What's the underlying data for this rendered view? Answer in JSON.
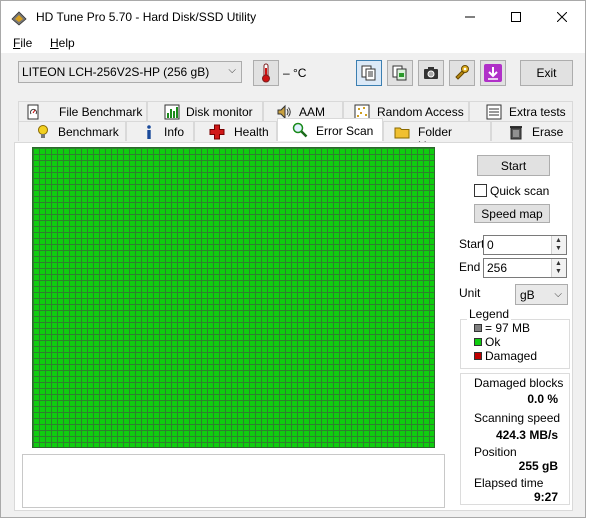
{
  "window": {
    "title": "HD Tune Pro 5.70 - Hard Disk/SSD Utility",
    "minimize": "—",
    "maximize": "☐",
    "close": "✕"
  },
  "menu": {
    "file_u": "F",
    "file_rest": "ile",
    "help_u": "H",
    "help_rest": "elp"
  },
  "toolbar": {
    "drive": "LITEON LCH-256V2S-HP (256 gB)",
    "temperature": "– °C",
    "exit_label": "Exit"
  },
  "tabs": {
    "row1": [
      "File Benchmark",
      "Disk monitor",
      "AAM",
      "Random Access",
      "Extra tests"
    ],
    "row2": [
      "Benchmark",
      "Info",
      "Health",
      "Error Scan",
      "Folder Usage",
      "Erase"
    ]
  },
  "scan": {
    "start_label": "Start",
    "quick_scan_label": "Quick scan",
    "speed_map_label": "Speed map",
    "start_field_label": "Start",
    "start_value": "0",
    "end_field_label": "End",
    "end_value": "256",
    "unit_label": "Unit",
    "unit_value": "gB"
  },
  "legend": {
    "title": "Legend",
    "block_size": "= 97 MB",
    "ok": "Ok",
    "damaged": "Damaged"
  },
  "stats": {
    "damaged_blocks_label": "Damaged blocks",
    "damaged_blocks_value": "0.0 %",
    "scanning_speed_label": "Scanning speed",
    "scanning_speed_value": "424.3 MB/s",
    "position_label": "Position",
    "position_value": "255 gB",
    "elapsed_label": "Elapsed time",
    "elapsed_value": "9:27"
  },
  "colors": {
    "ok": "#0fcd0f",
    "damaged": "#c00000",
    "block": "#808080"
  }
}
